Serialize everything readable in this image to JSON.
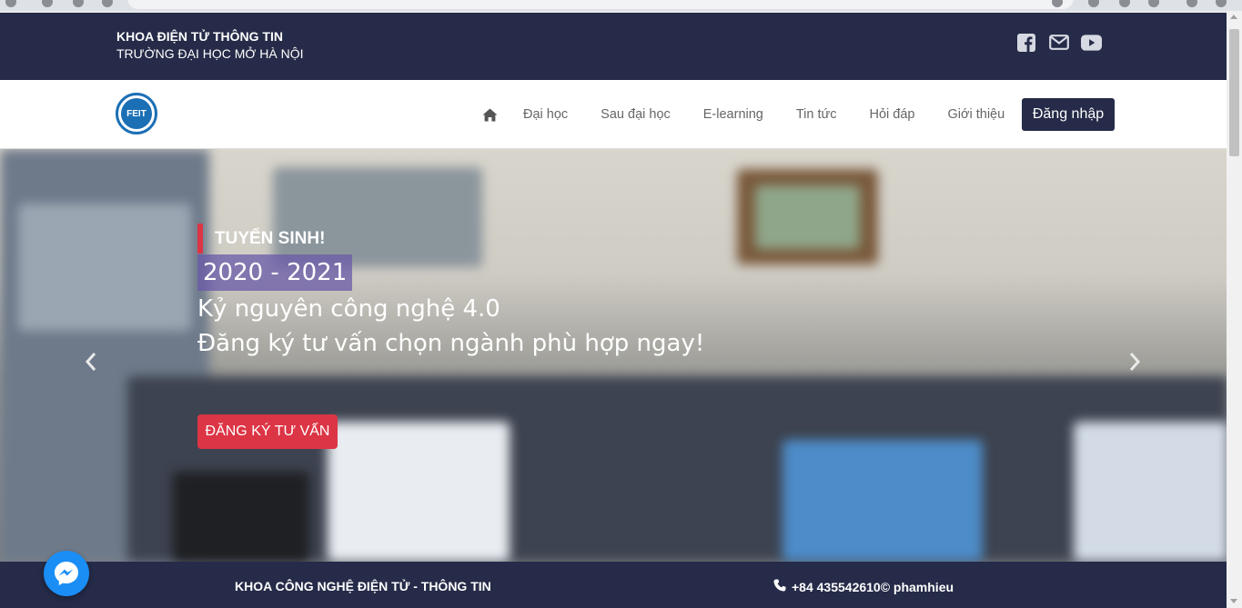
{
  "header": {
    "faculty_name": "KHOA ĐIỆN TỬ THÔNG TIN",
    "university_name": "TRƯỜNG ĐẠI HỌC MỞ HÀ NỘI",
    "social_icons": [
      "facebook-icon",
      "envelope-icon",
      "youtube-icon"
    ]
  },
  "nav": {
    "logo_text": "FEIT",
    "home_icon": "home-icon",
    "items": [
      {
        "label": "Đại học"
      },
      {
        "label": "Sau đại học"
      },
      {
        "label": "E-learning"
      },
      {
        "label": "Tin tức"
      },
      {
        "label": "Hỏi đáp"
      },
      {
        "label": "Giới thiệu"
      }
    ],
    "login_label": "Đăng nhập"
  },
  "hero": {
    "tag": "TUYỂN SINH!",
    "year": "2020 - 2021",
    "line1": "Kỷ nguyên công nghệ 4.0",
    "line2": "Đăng ký tư vấn chọn ngành phù hợp ngay!",
    "cta_label": "ĐĂNG KÝ TƯ VẤN",
    "prev_icon": "chevron-left-icon",
    "next_icon": "chevron-right-icon"
  },
  "footer": {
    "left_text": "KHOA CÔNG NGHỆ ĐIỆN TỬ - THÔNG TIN",
    "contact_text": "+84 435542610© phamhieu",
    "contact_icon": "phone-icon"
  },
  "widgets": {
    "messenger_icon": "messenger-icon"
  },
  "colors": {
    "primary_dark": "#252b48",
    "accent_red": "#dc3545",
    "tag_purple": "#6a5aa8",
    "messenger_blue": "#1a8ef5"
  }
}
